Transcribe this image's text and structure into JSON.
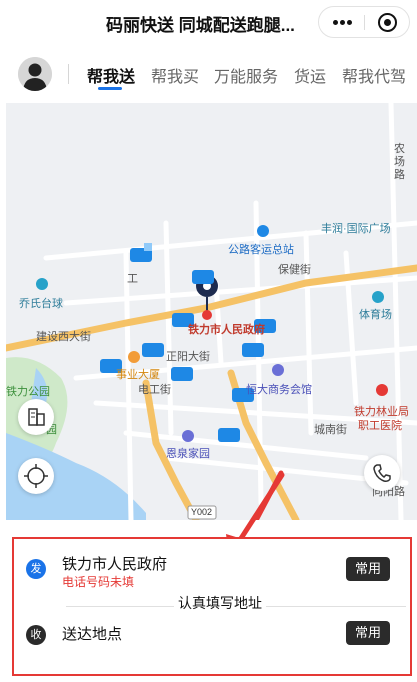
{
  "header": {
    "app_title": "码丽快送 同城配送跑腿...",
    "more_icon": "more-dots-icon",
    "close_icon": "target-circle-icon"
  },
  "tabs": [
    {
      "label": "帮我送",
      "active": true
    },
    {
      "label": "帮我买",
      "active": false
    },
    {
      "label": "万能服务",
      "active": false
    },
    {
      "label": "货运",
      "active": false
    },
    {
      "label": "帮我代驾",
      "active": false
    }
  ],
  "map": {
    "labels": {
      "nongchang_road": "农场路",
      "fengrun_plaza": "丰润·国际广场",
      "bus_station": "公路客运总站",
      "baojian_street": "保健街",
      "gongwei": "工",
      "qiaoshi": "乔氏台球",
      "tiyuchang": "体育场",
      "jianshe_west": "建设西大街",
      "gov": "铁力市人民政府",
      "zhengyang": "正阳大街",
      "shiyedasha": "事业大厦",
      "diangong": "电工街",
      "hengda": "恒大商务会馆",
      "tieli_park": "铁力公园",
      "yuan": "园",
      "chengnan": "城南街",
      "linyebu": "铁力林业局",
      "zhigong_hosp": "职工医院",
      "enquan": "恩泉家园",
      "xiangyang": "向阳路",
      "road_code": "Y002"
    },
    "city_btn_icon": "city-buildings-icon",
    "locate_btn_icon": "locate-crosshair-icon",
    "phone_btn_icon": "phone-icon"
  },
  "order": {
    "sender": {
      "badge": "发",
      "name": "铁力市人民政府",
      "warning": "电话号码未填",
      "button": "常用"
    },
    "note": "认真填写地址",
    "receiver": {
      "badge": "收",
      "name": "送达地点",
      "button": "常用"
    }
  },
  "colors": {
    "accent": "#1a73e8",
    "highlight_border": "#e53935",
    "warning_text": "#e53935",
    "road_major": "#f5c266",
    "water": "#a9d3f5",
    "park": "#cfe9c9"
  }
}
